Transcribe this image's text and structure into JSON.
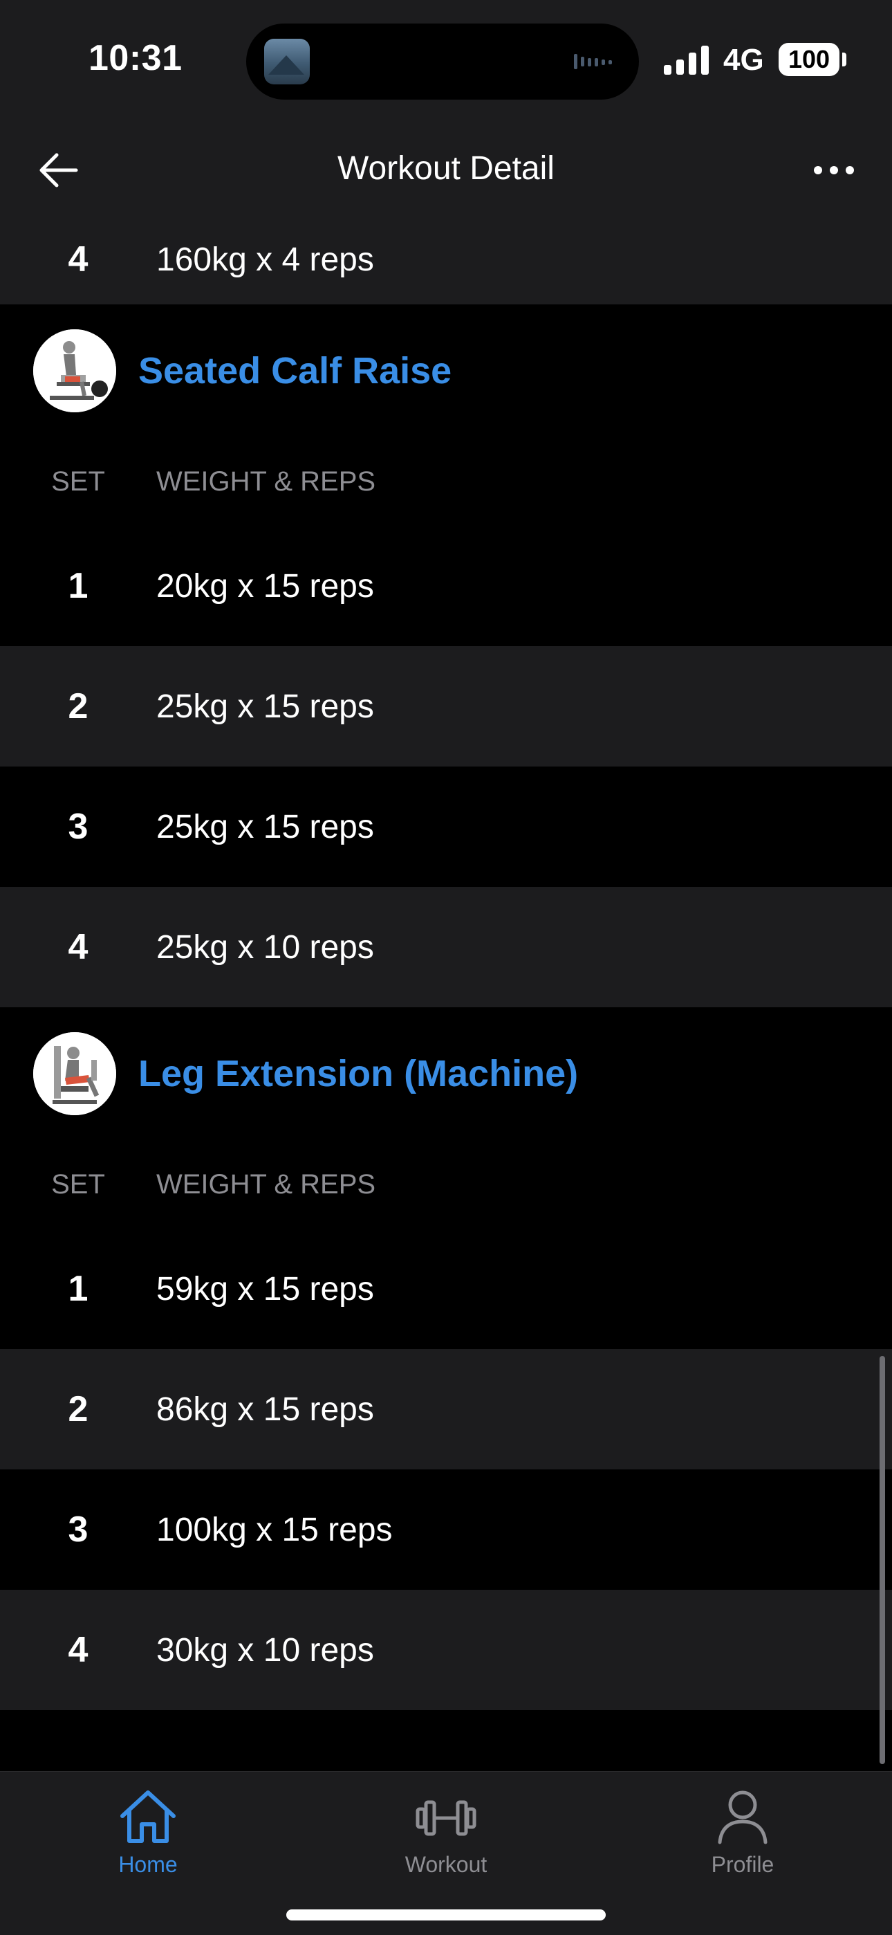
{
  "status_bar": {
    "time": "10:31",
    "network": "4G",
    "battery": "100"
  },
  "nav": {
    "title": "Workout Detail",
    "back_icon": "arrow-left-icon",
    "more_icon": "ellipsis-icon"
  },
  "previous_exercise": {
    "sets": [
      {
        "set": "4",
        "value": "160kg x 4 reps"
      }
    ]
  },
  "exercises": [
    {
      "name": "Seated Calf Raise",
      "col_set": "SET",
      "col_weight": "WEIGHT & REPS",
      "sets": [
        {
          "set": "1",
          "value": "20kg x 15 reps"
        },
        {
          "set": "2",
          "value": "25kg x 15 reps"
        },
        {
          "set": "3",
          "value": "25kg x 15 reps"
        },
        {
          "set": "4",
          "value": "25kg x 10 reps"
        }
      ]
    },
    {
      "name": "Leg Extension (Machine)",
      "col_set": "SET",
      "col_weight": "WEIGHT & REPS",
      "sets": [
        {
          "set": "1",
          "value": "59kg x 15 reps"
        },
        {
          "set": "2",
          "value": "86kg x 15 reps"
        },
        {
          "set": "3",
          "value": "100kg x 15 reps"
        },
        {
          "set": "4",
          "value": "30kg x 10 reps"
        }
      ]
    }
  ],
  "tabs": [
    {
      "label": "Home",
      "icon": "home-icon",
      "active": true
    },
    {
      "label": "Workout",
      "icon": "dumbbell-icon",
      "active": false
    },
    {
      "label": "Profile",
      "icon": "person-icon",
      "active": false
    }
  ],
  "colors": {
    "accent": "#3a8ee6",
    "row_alt": "#1c1c1e",
    "muted": "#8e8e93"
  }
}
